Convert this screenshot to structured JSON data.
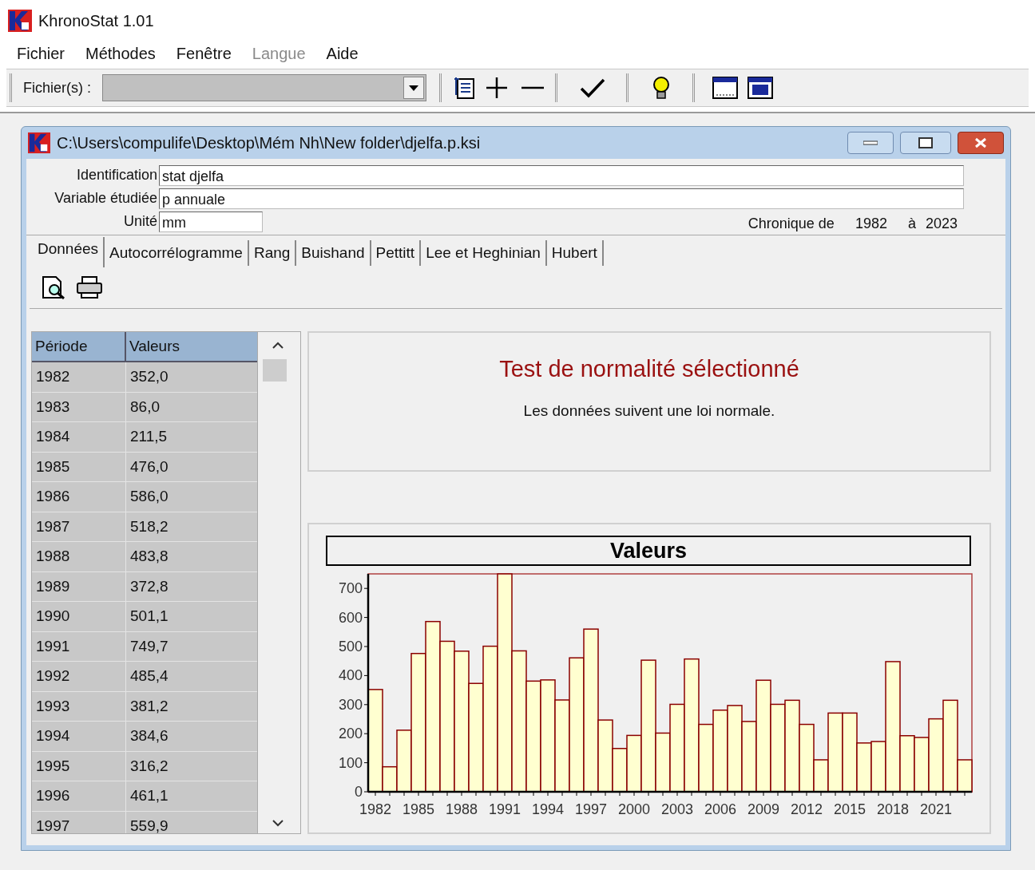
{
  "app": {
    "title": "KhronoStat 1.01"
  },
  "menu": [
    {
      "label": "Fichier",
      "disabled": false
    },
    {
      "label": "Méthodes",
      "disabled": false
    },
    {
      "label": "Fenêtre",
      "disabled": false
    },
    {
      "label": "Langue",
      "disabled": true
    },
    {
      "label": "Aide",
      "disabled": false
    }
  ],
  "toolbar": {
    "files_label": "Fichier(s) :"
  },
  "document_window": {
    "title": "C:\\Users\\compulife\\Desktop\\Mém Nh\\New folder\\djelfa.p.ksi",
    "fields": [
      {
        "label": "Identification",
        "value": "stat djelfa"
      },
      {
        "label": "Variable étudiée",
        "value": "p annuale"
      },
      {
        "label": "Unité",
        "value": "mm"
      }
    ],
    "chronique": {
      "label": "Chronique de",
      "start": "1982",
      "to": "à",
      "end": "2023"
    }
  },
  "tabs": [
    {
      "label": "Données",
      "selected": true
    },
    {
      "label": "Autocorrélogramme",
      "selected": false
    },
    {
      "label": "Rang",
      "selected": false
    },
    {
      "label": "Buishand",
      "selected": false
    },
    {
      "label": "Pettitt",
      "selected": false
    },
    {
      "label": "Lee et Heghinian",
      "selected": false
    },
    {
      "label": "Hubert",
      "selected": false
    }
  ],
  "table": {
    "columns": [
      "Période",
      "Valeurs"
    ],
    "rows": [
      [
        "1982",
        "352,0"
      ],
      [
        "1983",
        "86,0"
      ],
      [
        "1984",
        "211,5"
      ],
      [
        "1985",
        "476,0"
      ],
      [
        "1986",
        "586,0"
      ],
      [
        "1987",
        "518,2"
      ],
      [
        "1988",
        "483,8"
      ],
      [
        "1989",
        "372,8"
      ],
      [
        "1990",
        "501,1"
      ],
      [
        "1991",
        "749,7"
      ],
      [
        "1992",
        "485,4"
      ],
      [
        "1993",
        "381,2"
      ],
      [
        "1994",
        "384,6"
      ],
      [
        "1995",
        "316,2"
      ],
      [
        "1996",
        "461,1"
      ],
      [
        "1997",
        "559,9"
      ]
    ]
  },
  "result": {
    "title": "Test de normalité sélectionné",
    "message": "Les données suivent une loi normale."
  },
  "chart": {
    "chart_data": {
      "type": "bar",
      "title": "Valeurs",
      "x": [
        1982,
        1983,
        1984,
        1985,
        1986,
        1987,
        1988,
        1989,
        1990,
        1991,
        1992,
        1993,
        1994,
        1995,
        1996,
        1997,
        1998,
        1999,
        2000,
        2001,
        2002,
        2003,
        2004,
        2005,
        2006,
        2007,
        2008,
        2009,
        2010,
        2011,
        2012,
        2013,
        2014,
        2015,
        2016,
        2017,
        2018,
        2019,
        2020,
        2021,
        2022,
        2023
      ],
      "series": [
        {
          "color": "#ffffd0",
          "values": [
            352,
            86,
            212,
            476,
            586,
            518,
            484,
            373,
            501,
            750,
            485,
            381,
            385,
            316,
            461,
            560,
            247,
            149,
            194,
            453,
            202,
            301,
            457,
            232,
            281,
            297,
            242,
            384,
            301,
            315,
            232,
            110,
            271,
            271,
            168,
            173,
            448,
            193,
            187,
            251,
            315,
            110
          ]
        }
      ],
      "xlim": [
        1981.5,
        2023.5
      ],
      "ylim": [
        0,
        750
      ],
      "yticks": [
        0,
        100,
        200,
        300,
        400,
        500,
        600,
        700
      ],
      "xticks": [
        1982,
        1985,
        1988,
        1991,
        1994,
        1997,
        2000,
        2003,
        2006,
        2009,
        2012,
        2015,
        2018,
        2021
      ]
    }
  }
}
